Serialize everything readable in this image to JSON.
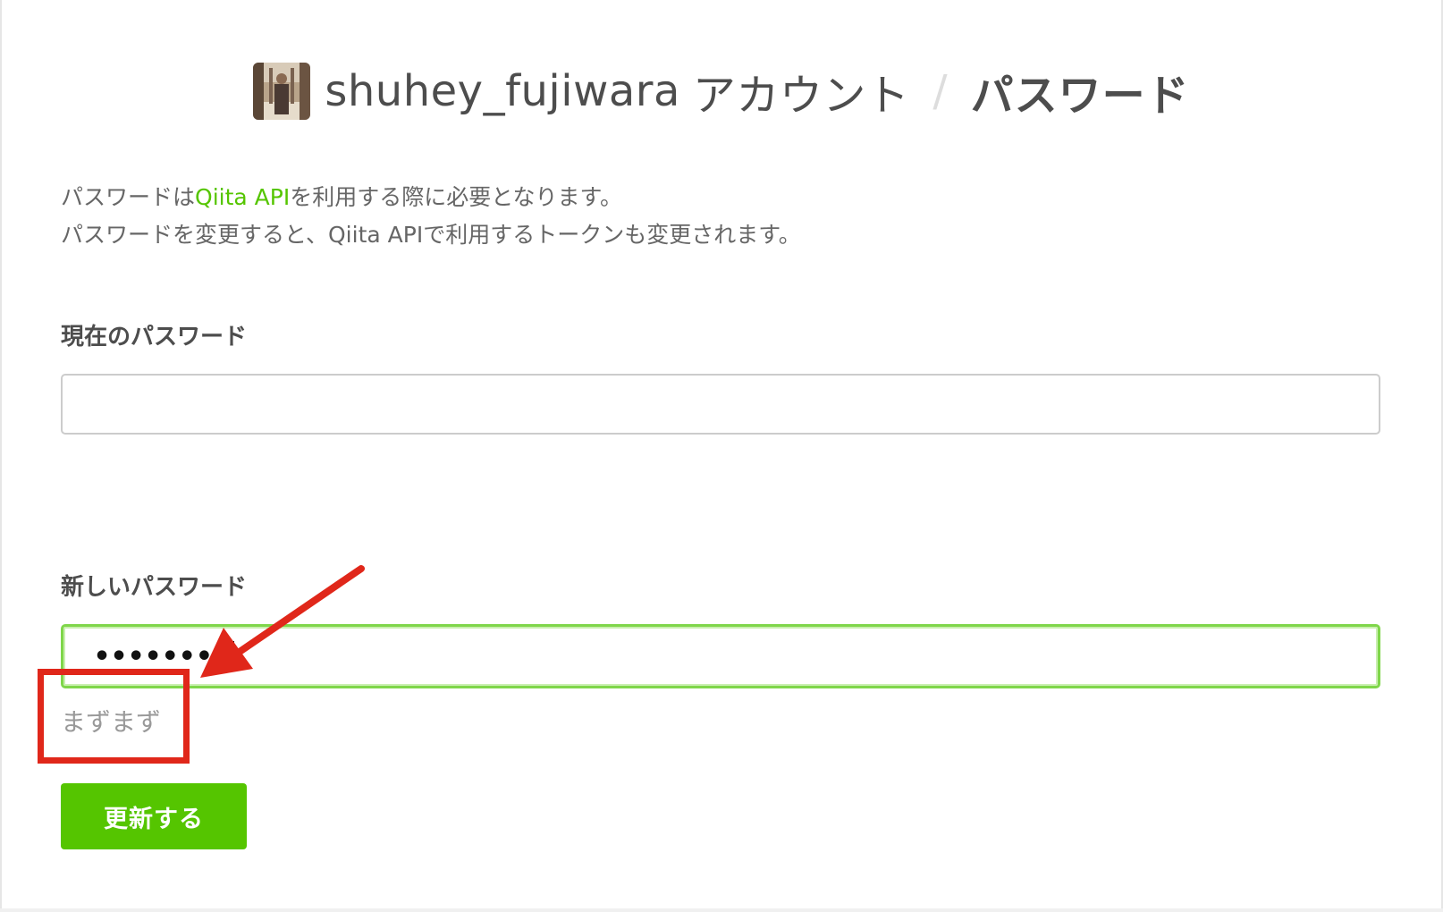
{
  "header": {
    "username": "shuhey_fujiwara",
    "account_label": "アカウント",
    "separator": "/",
    "page_title": "パスワード"
  },
  "description": {
    "line1_prefix": "パスワードは",
    "line1_link": "Qiita API",
    "line1_suffix": "を利用する際に必要となります。",
    "line2": "パスワードを変更すると、Qiita APIで利用するトークンも変更されます。"
  },
  "form": {
    "current_password": {
      "label": "現在のパスワード",
      "value": ""
    },
    "new_password": {
      "label": "新しいパスワード",
      "value": "••••••••"
    },
    "strength_text": "まずまず",
    "submit_label": "更新する"
  },
  "colors": {
    "accent_green": "#55c500",
    "annotation_red": "#e0271a"
  },
  "icons": {
    "avatar": "user-avatar-photo",
    "annotation_arrow": "red-arrow-icon"
  }
}
